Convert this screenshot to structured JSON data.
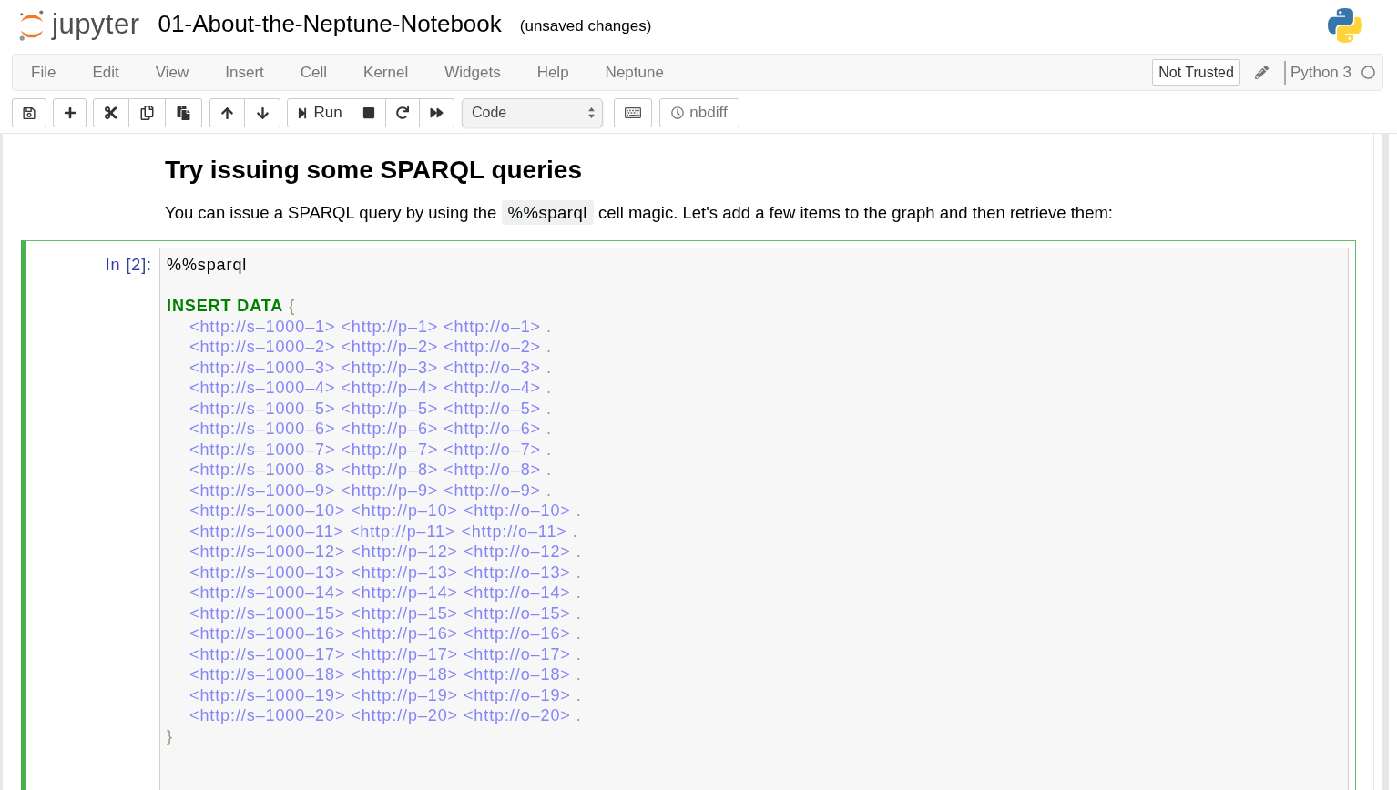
{
  "header": {
    "logo_text": "jupyter",
    "notebook_title": "01-About-the-Neptune-Notebook",
    "save_status": "(unsaved changes)"
  },
  "menubar": {
    "items": [
      "File",
      "Edit",
      "View",
      "Insert",
      "Cell",
      "Kernel",
      "Widgets",
      "Help",
      "Neptune"
    ],
    "trust_button": "Not Trusted",
    "kernel_name": "Python 3",
    "kernel_busy": false
  },
  "toolbar": {
    "run_label": "Run",
    "cell_type": "Code",
    "nbdiff_label": "nbdiff"
  },
  "cells": [
    {
      "kind": "markdown",
      "selected": false,
      "heading": "Try issuing some SPARQL queries",
      "paragraph": {
        "before": "You can issue a SPARQL query by using the",
        "code": "%%sparql",
        "after": "cell magic. Let's add a few items to the graph and then retrieve them:"
      }
    },
    {
      "kind": "code",
      "selected": true,
      "prompt": "In [2]:",
      "lines": [
        {
          "kind": "magic",
          "text": "%%sparql"
        },
        {
          "kind": "blank"
        },
        {
          "kind": "keyword",
          "keyword": "INSERT DATA",
          "bracket": "{"
        },
        {
          "kind": "triple",
          "terms": "<http://s–1000–1> <http://p–1> <http://o–1>",
          "end": "."
        },
        {
          "kind": "triple",
          "terms": "<http://s–1000–2> <http://p–2> <http://o–2>",
          "end": "."
        },
        {
          "kind": "triple",
          "terms": "<http://s–1000–3> <http://p–3> <http://o–3>",
          "end": "."
        },
        {
          "kind": "triple",
          "terms": "<http://s–1000–4> <http://p–4> <http://o–4>",
          "end": "."
        },
        {
          "kind": "triple",
          "terms": "<http://s–1000–5> <http://p–5> <http://o–5>",
          "end": "."
        },
        {
          "kind": "triple",
          "terms": "<http://s–1000–6> <http://p–6> <http://o–6>",
          "end": "."
        },
        {
          "kind": "triple",
          "terms": "<http://s–1000–7> <http://p–7> <http://o–7>",
          "end": "."
        },
        {
          "kind": "triple",
          "terms": "<http://s–1000–8> <http://p–8> <http://o–8>",
          "end": "."
        },
        {
          "kind": "triple",
          "terms": "<http://s–1000–9> <http://p–9> <http://o–9>",
          "end": "."
        },
        {
          "kind": "triple",
          "terms": "<http://s–1000–10> <http://p–10> <http://o–10>",
          "end": "."
        },
        {
          "kind": "triple",
          "terms": "<http://s–1000–11> <http://p–11> <http://o–11>",
          "end": "."
        },
        {
          "kind": "triple",
          "terms": "<http://s–1000–12> <http://p–12> <http://o–12>",
          "end": "."
        },
        {
          "kind": "triple",
          "terms": "<http://s–1000–13> <http://p–13> <http://o–13>",
          "end": "."
        },
        {
          "kind": "triple",
          "terms": "<http://s–1000–14> <http://p–14> <http://o–14>",
          "end": "."
        },
        {
          "kind": "triple",
          "terms": "<http://s–1000–15> <http://p–15> <http://o–15>",
          "end": "."
        },
        {
          "kind": "triple",
          "terms": "<http://s–1000–16> <http://p–16> <http://o–16>",
          "end": "."
        },
        {
          "kind": "triple",
          "terms": "<http://s–1000–17> <http://p–17> <http://o–17>",
          "end": "."
        },
        {
          "kind": "triple",
          "terms": "<http://s–1000–18> <http://p–18> <http://o–18>",
          "end": "."
        },
        {
          "kind": "triple",
          "terms": "<http://s–1000–19> <http://p–19> <http://o–19>",
          "end": "."
        },
        {
          "kind": "triple",
          "terms": "<http://s–1000–20> <http://p–20> <http://o–20>",
          "end": "."
        },
        {
          "kind": "bracket",
          "text": "}"
        }
      ]
    }
  ]
}
